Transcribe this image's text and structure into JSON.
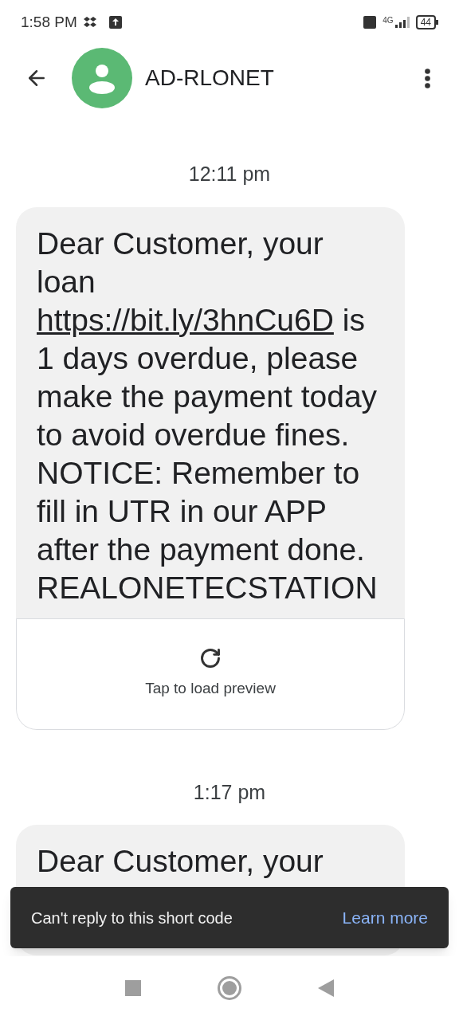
{
  "status_bar": {
    "time": "1:58 PM",
    "battery": "44",
    "network": "4G"
  },
  "header": {
    "title": "AD-RLONET"
  },
  "messages": [
    {
      "timestamp": "12:11 pm",
      "parts": [
        {
          "kind": "text",
          "text": "Dear Customer, your loan "
        },
        {
          "kind": "link",
          "text": "https://bit.ly/3hnCu6D"
        },
        {
          "kind": "text",
          "text": " is 1 days overdue, please make the payment today to avoid overdue fines. NOTICE: Remember to fill in UTR in our APP after the payment done. REALONETECSTATION"
        }
      ],
      "preview": {
        "label": "Tap to load preview"
      }
    },
    {
      "timestamp": "1:17 pm",
      "parts": [
        {
          "kind": "text",
          "text": "Dear Customer, your"
        }
      ]
    }
  ],
  "snackbar": {
    "message": "Can't reply to this short code",
    "action": "Learn more"
  }
}
